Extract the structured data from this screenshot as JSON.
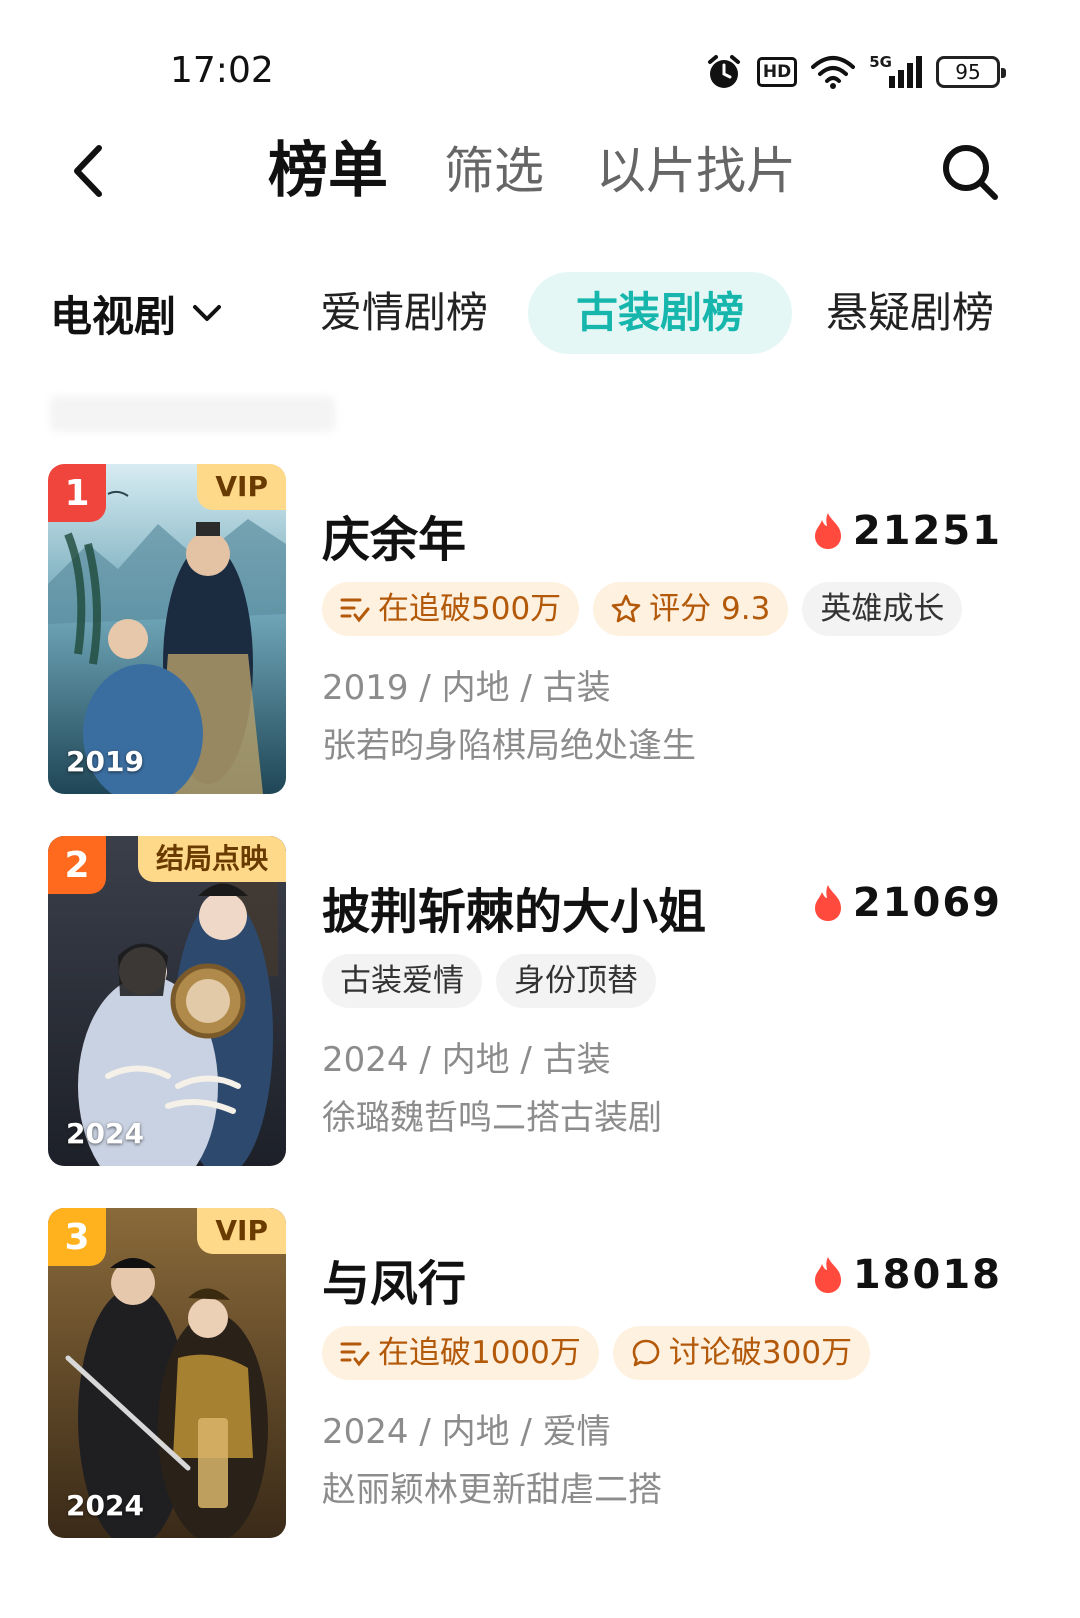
{
  "status_bar": {
    "time": "17:02",
    "hd_label": "HD",
    "signal_label": "5G",
    "battery": "95",
    "icons": [
      "alarm-icon",
      "hd-icon",
      "wifi-icon",
      "signal-icon",
      "battery-icon"
    ]
  },
  "header": {
    "tabs": [
      {
        "label": "榜单",
        "active": true
      },
      {
        "label": "筛选",
        "active": false
      },
      {
        "label": "以片找片",
        "active": false
      }
    ]
  },
  "category": {
    "selected": "电视剧",
    "tabs": [
      {
        "label": "爱情剧榜",
        "active": false
      },
      {
        "label": "古装剧榜",
        "active": true
      },
      {
        "label": "悬疑剧榜",
        "active": false
      }
    ]
  },
  "colors": {
    "accent": "#16b6ad",
    "accent_bg": "#e4f7f5",
    "rank1": "#f0453d",
    "rank2": "#ff6a1e",
    "rank3": "#ffb21e",
    "heat": "#ff4a3d"
  },
  "items": [
    {
      "rank": "1",
      "badge": "VIP",
      "poster_year": "2019",
      "title": "庆余年",
      "heat": "21251",
      "tags": [
        {
          "icon": "list-check-icon",
          "text": "在追破500万"
        },
        {
          "icon": "star-icon",
          "text": "评分 9.3"
        },
        {
          "icon": "",
          "text": "英雄成长"
        }
      ],
      "meta": "2019 / 内地 / 古装",
      "desc": "张若昀身陷棋局绝处逢生"
    },
    {
      "rank": "2",
      "badge": "结局点映",
      "poster_year": "2024",
      "title": "披荆斩棘的大小姐",
      "heat": "21069",
      "tags": [
        {
          "icon": "",
          "text": "古装爱情"
        },
        {
          "icon": "",
          "text": "身份顶替"
        }
      ],
      "meta": "2024 / 内地 / 古装",
      "desc": "徐璐魏哲鸣二搭古装剧"
    },
    {
      "rank": "3",
      "badge": "VIP",
      "poster_year": "2024",
      "title": "与凤行",
      "heat": "18018",
      "tags": [
        {
          "icon": "list-check-icon",
          "text": "在追破1000万"
        },
        {
          "icon": "comment-icon",
          "text": "讨论破300万"
        }
      ],
      "meta": "2024 / 内地 / 爱情",
      "desc": "赵丽颖林更新甜虐二搭"
    }
  ]
}
